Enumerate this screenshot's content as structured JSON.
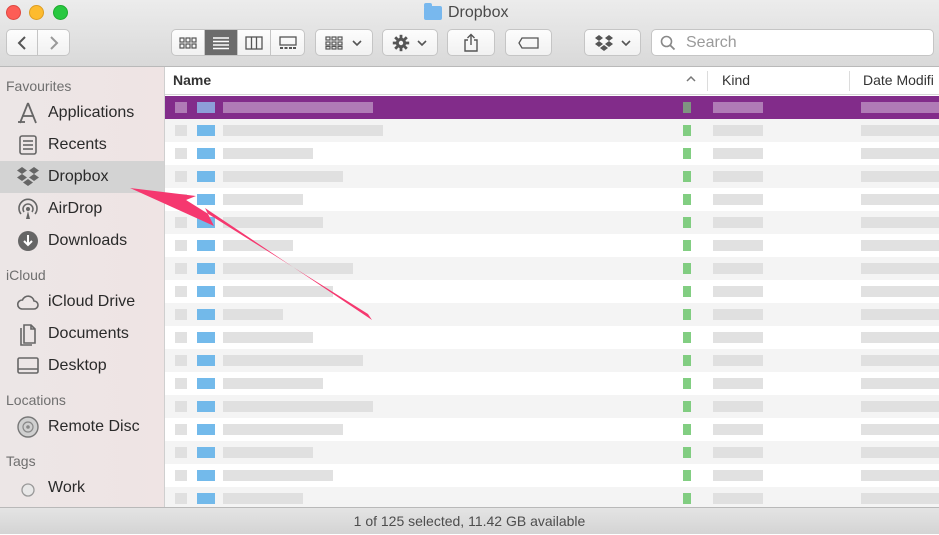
{
  "window": {
    "title": "Dropbox"
  },
  "toolbar": {
    "search_placeholder": "Search",
    "view_modes": [
      "icon-view",
      "list-view",
      "column-view",
      "gallery-view"
    ],
    "active_view": "list-view"
  },
  "sidebar": {
    "favourites": {
      "label": "Favourites",
      "items": [
        {
          "label": "Applications",
          "icon": "applications-icon"
        },
        {
          "label": "Recents",
          "icon": "recents-icon"
        },
        {
          "label": "Dropbox",
          "icon": "dropbox-icon",
          "selected": true
        },
        {
          "label": "AirDrop",
          "icon": "airdrop-icon"
        },
        {
          "label": "Downloads",
          "icon": "downloads-icon"
        }
      ]
    },
    "icloud": {
      "label": "iCloud",
      "items": [
        {
          "label": "iCloud Drive",
          "icon": "icloud-icon"
        },
        {
          "label": "Documents",
          "icon": "documents-icon"
        },
        {
          "label": "Desktop",
          "icon": "desktop-icon"
        }
      ]
    },
    "locations": {
      "label": "Locations",
      "items": [
        {
          "label": "Remote Disc",
          "icon": "disc-icon"
        }
      ]
    },
    "tags": {
      "label": "Tags",
      "items": [
        {
          "label": "Work",
          "icon": "tag-dot-icon"
        }
      ]
    }
  },
  "list": {
    "columns": {
      "name": "Name",
      "kind": "Kind",
      "date": "Date Modifi"
    },
    "selected_color": "#822c8a",
    "folder_color": "#5aaee8",
    "sync_color": "#6cc56c"
  },
  "status": {
    "text": "1 of 125 selected, 11.42 GB available"
  },
  "annotation": {
    "arrow_color": "#f5386f"
  }
}
